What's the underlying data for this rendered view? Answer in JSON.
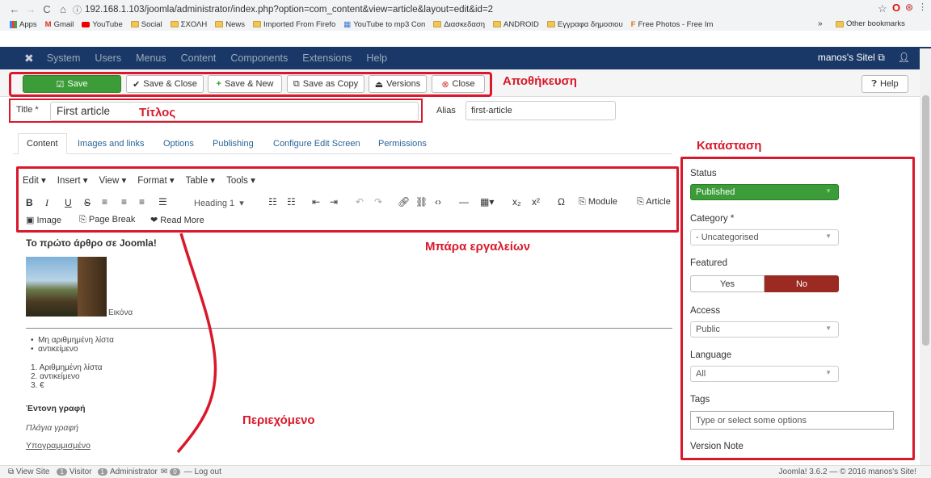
{
  "browser": {
    "url": "192.168.1.103/joomla/administrator/index.php?option=com_content&view=article&layout=edit&id=2",
    "bookmarks": [
      "Apps",
      "Gmail",
      "YouTube",
      "Social",
      "ΣΧΟΛΗ",
      "News",
      "Imported From Firefo",
      "YouTube to mp3 Con",
      "Διασκεδαση",
      "ANDROID",
      "Εγγραφα δημοσιου",
      "Free Photos - Free Im"
    ],
    "more": "»",
    "other_bookmarks": "Other bookmarks"
  },
  "joomla_header": {
    "menus": [
      "System",
      "Users",
      "Menus",
      "Content",
      "Components",
      "Extensions",
      "Help"
    ],
    "site_name": "manos's Sitel"
  },
  "toolbar": {
    "save": "Save",
    "save_close": "Save & Close",
    "save_new": "Save & New",
    "save_copy": "Save as Copy",
    "versions": "Versions",
    "close": "Close",
    "help": "Help"
  },
  "annotations": {
    "save_label": "Αποθήκευση",
    "title_label": "Τίτλος",
    "toolbar_label": "Μπάρα εργαλείων",
    "content_label": "Περιεχόμενο",
    "status_label": "Κατάσταση"
  },
  "form": {
    "title_label": "Title *",
    "title_value": "First article",
    "alias_label": "Alias",
    "alias_value": "first-article"
  },
  "tabs": [
    "Content",
    "Images and links",
    "Options",
    "Publishing",
    "Configure Edit Screen",
    "Permissions"
  ],
  "editor": {
    "menus": [
      "Edit ▾",
      "Insert ▾",
      "View ▾",
      "Format ▾",
      "Table ▾",
      "Tools ▾"
    ],
    "heading_select": "Heading 1",
    "module_btn": "Module",
    "article_btn": "Article",
    "image_btn": "Image",
    "pagebreak_btn": "Page Break",
    "readmore_btn": "Read More"
  },
  "content": {
    "heading": "Το πρώτο άρθρο σε Joomla!",
    "image_caption": "Εικόνα",
    "ul_items": [
      "Μη αριθμημένη λίστα",
      "αντικείμενο"
    ],
    "ol_items": [
      "Αριθμημένη λίστα",
      "αντικείμενο",
      "€"
    ],
    "bold": "Έντονη γραφή",
    "italic": "Πλάγια γραφή",
    "underline": "Υπογραμμισμένο"
  },
  "sidebar": {
    "status_label": "Status",
    "status_value": "Published",
    "category_label": "Category *",
    "category_value": "- Uncategorised",
    "featured_label": "Featured",
    "featured_yes": "Yes",
    "featured_no": "No",
    "access_label": "Access",
    "access_value": "Public",
    "language_label": "Language",
    "language_value": "All",
    "tags_label": "Tags",
    "tags_placeholder": "Type or select some options",
    "version_note_label": "Version Note"
  },
  "footer": {
    "view_site": "View Site",
    "visitor_count": "1",
    "visitor": "Visitor",
    "admin_count": "1",
    "administrator": "Administrator",
    "msg_count": "0",
    "logout": "Log out",
    "copyright": "Joomla! 3.6.2 — © 2016 manos's Site!"
  },
  "colors": {
    "joomla_nav": "#1a3867",
    "save_green": "#3c9c38",
    "featured_no": "#9b2a22",
    "annotation_red": "#d9182b"
  }
}
